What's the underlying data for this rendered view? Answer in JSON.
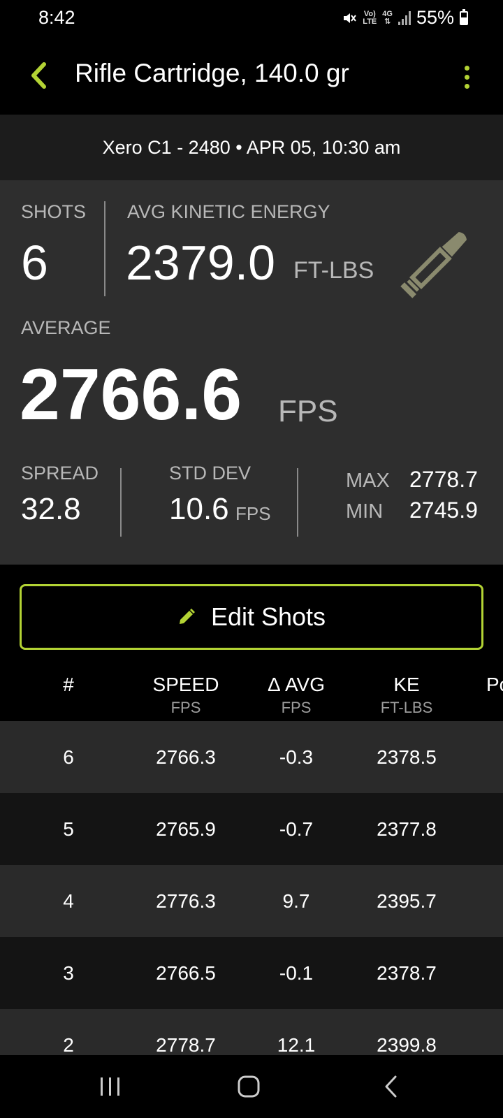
{
  "status_bar": {
    "time": "8:42",
    "volte_top": "Vo)",
    "volte_bottom": "LTE",
    "network": "4G",
    "battery": "55%"
  },
  "header": {
    "title": "Rifle Cartridge, 140.0 gr",
    "back_icon": "chevron-left-icon",
    "menu_icon": "more-vertical-icon",
    "accent_color": "#b3d334"
  },
  "session": {
    "text": "Xero C1 - 2480 • APR 05, 10:30 am"
  },
  "stats": {
    "shots_label": "SHOTS",
    "shots_value": "6",
    "ke_label": "AVG KINETIC ENERGY",
    "ke_value": "2379.0",
    "ke_unit": "FT-LBS",
    "average_label": "AVERAGE",
    "average_value": "2766.6",
    "average_unit": "FPS",
    "spread_label": "SPREAD",
    "spread_value": "32.8",
    "stddev_label": "STD DEV",
    "stddev_value": "10.6",
    "stddev_unit": "FPS",
    "max_label": "MAX",
    "max_value": "2778.7",
    "min_label": "MIN",
    "min_value": "2745.9",
    "bullet_icon": "bullet-icon",
    "bullet_color": "#8a8a6e"
  },
  "edit_button": {
    "label": "Edit Shots",
    "icon": "pencil-icon"
  },
  "table": {
    "headers": [
      {
        "title": "#",
        "unit": ""
      },
      {
        "title": "SPEED",
        "unit": "FPS"
      },
      {
        "title": "Δ AVG",
        "unit": "FPS"
      },
      {
        "title": "KE",
        "unit": "FT-LBS"
      },
      {
        "title": "Po",
        "unit": ""
      }
    ],
    "rows": [
      {
        "num": "6",
        "speed": "2766.3",
        "delta": "-0.3",
        "ke": "2378.5"
      },
      {
        "num": "5",
        "speed": "2765.9",
        "delta": "-0.7",
        "ke": "2377.8"
      },
      {
        "num": "4",
        "speed": "2776.3",
        "delta": "9.7",
        "ke": "2395.7"
      },
      {
        "num": "3",
        "speed": "2766.5",
        "delta": "-0.1",
        "ke": "2378.7"
      },
      {
        "num": "2",
        "speed": "2778.7",
        "delta": "12.1",
        "ke": "2399.8"
      }
    ]
  },
  "nav_bar": {
    "recents_icon": "recents-icon",
    "home_icon": "home-icon",
    "back_icon": "nav-back-icon"
  }
}
